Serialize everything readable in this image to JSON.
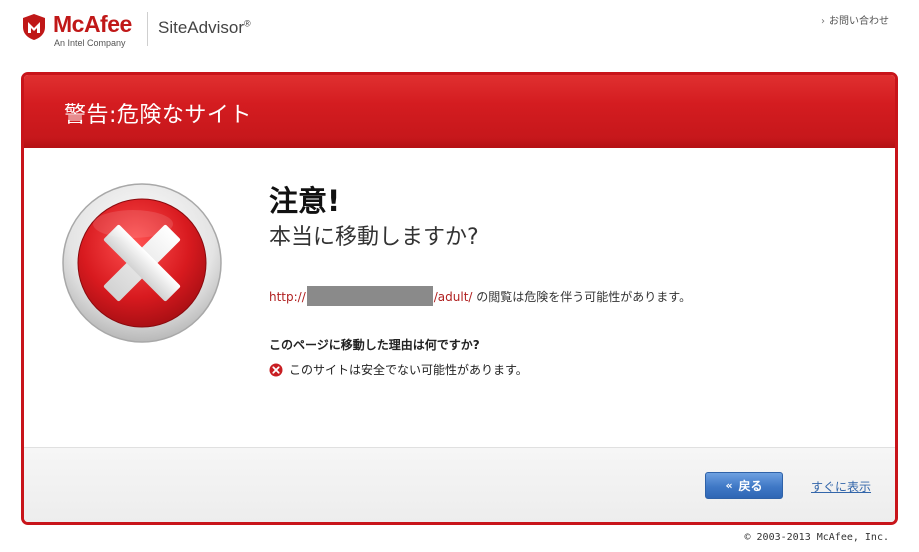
{
  "header": {
    "brand": "McAfee",
    "brand_sub": "An Intel Company",
    "product": "SiteAdvisor",
    "product_mark": "®",
    "contact_link": "お問い合わせ"
  },
  "panel": {
    "title": "警告:危険なサイト",
    "caution": "注意!",
    "question": "本当に移動しますか?",
    "url_prefix": "http://",
    "url_suffix": "/adult/",
    "url_message": " の閲覧は危険を伴う可能性があります。",
    "reason_heading": "このページに移動した理由は何ですか?",
    "reason_item": "このサイトは安全でない可能性があります。"
  },
  "footer_actions": {
    "back_label": "戻る",
    "show_now_label": "すぐに表示"
  },
  "copyright": "© 2003-2013 McAfee, Inc.",
  "icons": {
    "logo": "mcafee-shield-icon",
    "warning": "red-x-warning-icon",
    "reason": "small-red-x-icon",
    "back": "double-chevron-left-icon"
  },
  "colors": {
    "brand_red": "#c01818",
    "panel_border": "#c8141a",
    "button_blue": "#3f78c6",
    "link_blue": "#3366aa"
  }
}
